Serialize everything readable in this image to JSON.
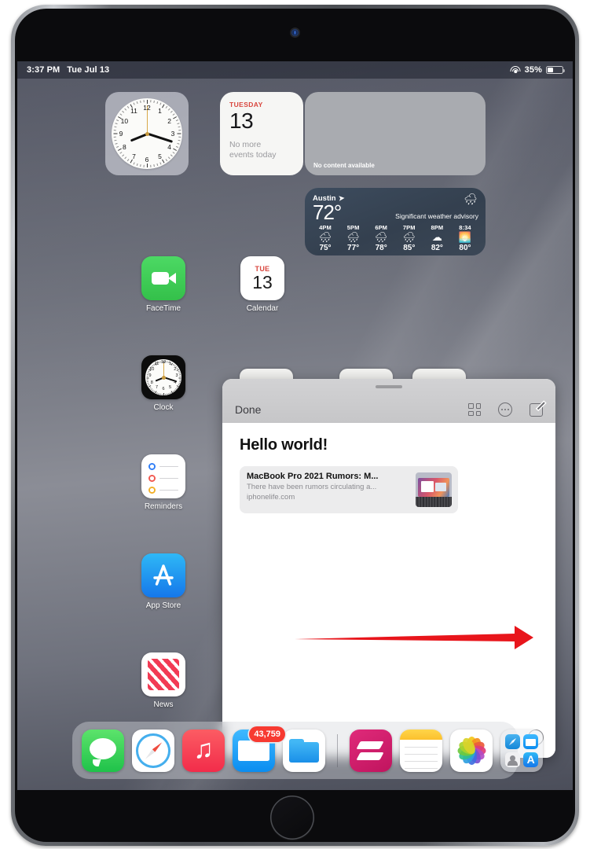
{
  "status_bar": {
    "time": "3:37 PM",
    "date": "Tue Jul 13",
    "battery_percent": "35%",
    "wifi_icon": "wifi-icon",
    "battery_icon": "battery-icon"
  },
  "widgets": {
    "clock": {
      "name": "Clock widget",
      "hour": 8,
      "minute": 18,
      "second": 0
    },
    "calendar": {
      "day_of_week": "TUESDAY",
      "day_number": "13",
      "events_text": "No more\nevents today"
    },
    "blank": {
      "message": "No content available"
    },
    "weather": {
      "city": "Austin",
      "location_icon": "location-arrow-icon",
      "temperature": "72°",
      "advisory": "Significant weather advisory",
      "condition_icon": "rain-cloud-icon",
      "hours": [
        {
          "label": "4PM",
          "icon": "🌧",
          "temp": "75°"
        },
        {
          "label": "5PM",
          "icon": "🌧",
          "temp": "77°"
        },
        {
          "label": "6PM",
          "icon": "🌧",
          "temp": "78°"
        },
        {
          "label": "7PM",
          "icon": "🌧",
          "temp": "85°"
        },
        {
          "label": "8PM",
          "icon": "☁",
          "temp": "82°"
        },
        {
          "label": "8:34",
          "icon": "🌅",
          "temp": "80°"
        }
      ]
    }
  },
  "home_apps": [
    {
      "label": "FaceTime",
      "icon": "facetime-icon"
    },
    {
      "label": "Calendar",
      "icon": "calendar-icon",
      "dow": "TUE",
      "day": "13"
    },
    {
      "label": "Clock",
      "icon": "clock-icon"
    },
    {
      "label": "Reminders",
      "icon": "reminders-icon"
    },
    {
      "label": "App Store",
      "icon": "app-store-icon"
    },
    {
      "label": "News",
      "icon": "news-icon"
    }
  ],
  "notes_sheet": {
    "done_label": "Done",
    "toolbar_icons": [
      "grid-icon",
      "more-circle-icon",
      "compose-icon"
    ],
    "note_title": "Hello world!",
    "link_preview": {
      "title": "MacBook Pro 2021 Rumors: M...",
      "description": "There have been rumors circulating a...",
      "url": "iphonelife.com"
    },
    "markup_icon": "markup-pen-icon",
    "annotation": {
      "type": "red-arrow",
      "direction": "right",
      "color": "#e8151b"
    }
  },
  "dock": {
    "items": [
      {
        "label": "Messages",
        "icon": "messages-icon"
      },
      {
        "label": "Safari",
        "icon": "safari-icon"
      },
      {
        "label": "Music",
        "icon": "music-icon"
      },
      {
        "label": "Mail",
        "icon": "mail-icon",
        "badge": "43,759"
      },
      {
        "label": "Files",
        "icon": "files-icon"
      },
      {
        "label": "Skitch",
        "icon": "skitch-icon"
      },
      {
        "label": "Notes",
        "icon": "notes-icon"
      },
      {
        "label": "Photos",
        "icon": "photos-icon"
      },
      {
        "label": "Folder",
        "icon": "folder-icon"
      }
    ]
  },
  "colors": {
    "accent_red": "#e8151b",
    "calendar_red": "#d9463e",
    "badge_red": "#f73a31"
  }
}
